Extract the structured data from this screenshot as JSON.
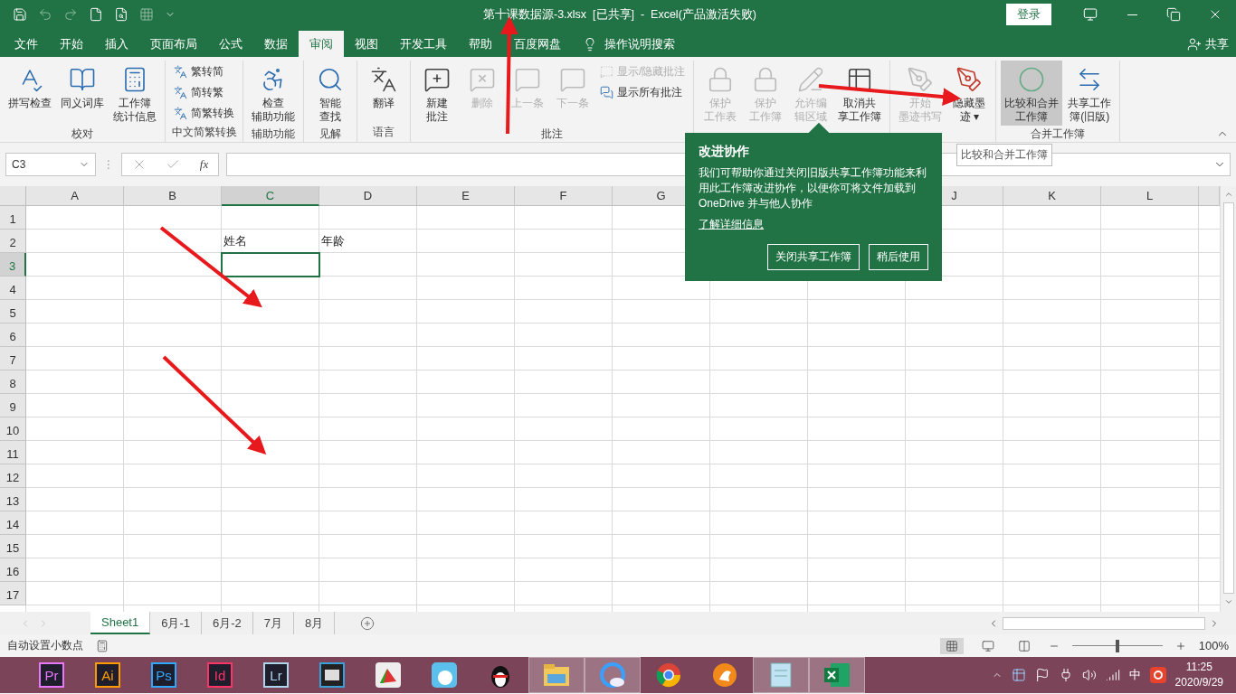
{
  "title_bar": {
    "title": "第十课数据源-3.xlsx  [已共享]  -  Excel(产品激活失败)",
    "login": "登录"
  },
  "tabs": [
    {
      "label": "文件",
      "selected": false
    },
    {
      "label": "开始",
      "selected": false
    },
    {
      "label": "插入",
      "selected": false
    },
    {
      "label": "页面布局",
      "selected": false
    },
    {
      "label": "公式",
      "selected": false
    },
    {
      "label": "数据",
      "selected": false
    },
    {
      "label": "审阅",
      "selected": true
    },
    {
      "label": "视图",
      "selected": false
    },
    {
      "label": "开发工具",
      "selected": false
    },
    {
      "label": "帮助",
      "selected": false
    },
    {
      "label": "百度网盘",
      "selected": false
    }
  ],
  "search": {
    "placeholder": "操作说明搜索"
  },
  "share": "共享",
  "ribbon": {
    "groups": [
      {
        "label": "校对",
        "buttons": [
          {
            "lines": [
              "拼写检查"
            ],
            "disabled": false,
            "highlighted": false
          },
          {
            "lines": [
              "同义词库"
            ],
            "disabled": false,
            "highlighted": false
          },
          {
            "lines": [
              "工作簿",
              "统计信息"
            ],
            "disabled": false,
            "highlighted": false
          }
        ]
      },
      {
        "label": "中文简繁转换",
        "small_items": [
          {
            "label": "繁转简",
            "disabled": false
          },
          {
            "label": "简转繁",
            "disabled": false
          },
          {
            "label": "简繁转换",
            "disabled": false
          }
        ]
      },
      {
        "label": "辅助功能",
        "buttons": [
          {
            "lines": [
              "检查",
              "辅助功能"
            ],
            "disabled": false,
            "highlighted": false
          }
        ]
      },
      {
        "label": "见解",
        "buttons": [
          {
            "lines": [
              "智能",
              "查找"
            ],
            "disabled": false,
            "highlighted": false
          }
        ]
      },
      {
        "label": "语言",
        "buttons": [
          {
            "lines": [
              "翻译"
            ],
            "disabled": false,
            "highlighted": false
          }
        ]
      },
      {
        "label": "批注",
        "buttons": [
          {
            "lines": [
              "新建",
              "批注"
            ],
            "disabled": false,
            "highlighted": false
          },
          {
            "lines": [
              "删除"
            ],
            "disabled": true,
            "highlighted": false
          },
          {
            "lines": [
              "上一条"
            ],
            "disabled": true,
            "highlighted": false
          },
          {
            "lines": [
              "下一条"
            ],
            "disabled": true,
            "highlighted": false
          }
        ],
        "small_items": [
          {
            "label": "显示/隐藏批注",
            "disabled": true
          },
          {
            "label": "显示所有批注",
            "disabled": false
          }
        ]
      },
      {
        "buttons": [
          {
            "lines": [
              "保护",
              "工作表"
            ],
            "disabled": true,
            "highlighted": false
          },
          {
            "lines": [
              "保护",
              "工作簿"
            ],
            "disabled": true,
            "highlighted": false
          },
          {
            "lines": [
              "允许编",
              "辑区域"
            ],
            "disabled": true,
            "highlighted": false
          },
          {
            "lines": [
              "取消共",
              "享工作簿"
            ],
            "disabled": false,
            "highlighted": false
          }
        ]
      },
      {
        "buttons": [
          {
            "lines": [
              "开始",
              "墨迹书写"
            ],
            "disabled": true,
            "highlighted": false
          },
          {
            "lines": [
              "隐藏墨",
              "迹 ▾"
            ],
            "disabled": false,
            "highlighted": false
          }
        ]
      },
      {
        "label": "合并工作簿",
        "buttons": [
          {
            "lines": [
              "比较和合并",
              "工作簿"
            ],
            "disabled": false,
            "highlighted": true
          },
          {
            "lines": [
              "共享工作",
              "簿(旧版)"
            ],
            "disabled": false,
            "highlighted": false
          }
        ]
      }
    ]
  },
  "tooltip": "比较和合并工作簿",
  "formula_bar": {
    "name_box": "C3",
    "separator": "⋮",
    "fx": "fx"
  },
  "grid": {
    "columns": [
      {
        "label": "A",
        "selected": false
      },
      {
        "label": "B",
        "selected": false
      },
      {
        "label": "C",
        "selected": true
      },
      {
        "label": "D",
        "selected": false
      },
      {
        "label": "E",
        "selected": false
      },
      {
        "label": "F",
        "selected": false
      },
      {
        "label": "G",
        "selected": false
      },
      {},
      {},
      {
        "label": "J",
        "selected": false
      },
      {
        "label": "K",
        "selected": false
      },
      {
        "label": "L",
        "selected": false
      }
    ],
    "rows": [
      {
        "label": "1",
        "selected": false
      },
      {
        "label": "2",
        "selected": false,
        "cells": [
          null,
          null,
          "姓名",
          "年龄"
        ]
      },
      {
        "label": "3",
        "selected": true
      },
      {
        "label": "4",
        "selected": false
      },
      {
        "label": "5",
        "selected": false
      },
      {
        "label": "6",
        "selected": false
      },
      {
        "label": "7",
        "selected": false
      },
      {
        "label": "8",
        "selected": false
      },
      {
        "label": "9",
        "selected": false
      },
      {
        "label": "10",
        "selected": false
      },
      {
        "label": "11",
        "selected": false
      },
      {
        "label": "12",
        "selected": false
      },
      {
        "label": "13",
        "selected": false
      },
      {
        "label": "14",
        "selected": false
      },
      {
        "label": "15",
        "selected": false
      },
      {
        "label": "16",
        "selected": false
      },
      {
        "label": "17",
        "selected": false
      }
    ]
  },
  "popup": {
    "title": "改进协作",
    "body": "我们可帮助你通过关闭旧版共享工作簿功能来利用此工作簿改进协作，以便你可将文件加载到 OneDrive 并与他人协作",
    "link": "了解详细信息",
    "buttons": [
      "关闭共享工作簿",
      "稍后使用"
    ]
  },
  "sheet_tabs": [
    {
      "label": "Sheet1",
      "selected": true
    },
    {
      "label": "6月-1",
      "selected": false
    },
    {
      "label": "6月-2",
      "selected": false
    },
    {
      "label": "7月",
      "selected": false
    },
    {
      "label": "8月",
      "selected": false
    }
  ],
  "status_bar": {
    "text": "自动设置小数点",
    "views": [
      {
        "selected": true
      },
      {
        "selected": false
      },
      {
        "selected": false
      }
    ],
    "zoom": {
      "level": 0.5,
      "reading": "100%"
    }
  },
  "taskbar": {
    "apps": [
      {
        "kind": "tile",
        "label": "Pr",
        "color": "#ea77ff",
        "active": false
      },
      {
        "kind": "tile",
        "label": "Ai",
        "color": "#ff9a00",
        "active": false
      },
      {
        "kind": "tile",
        "label": "Ps",
        "color": "#31a8ff",
        "active": false
      },
      {
        "kind": "tile",
        "label": "Id",
        "color": "#ff3366",
        "active": false
      },
      {
        "kind": "tile",
        "label": "Lr",
        "color": "#add5ec",
        "active": false
      },
      {
        "kind": "film",
        "active": false
      },
      {
        "kind": "chart",
        "active": false
      },
      {
        "kind": "bunny",
        "active": false
      },
      {
        "kind": "penguin",
        "active": false
      },
      {
        "kind": "folder",
        "active": true
      },
      {
        "kind": "cloud",
        "active": true
      },
      {
        "kind": "chrome",
        "active": false
      },
      {
        "kind": "fox",
        "active": false
      },
      {
        "kind": "notepad",
        "active": true
      },
      {
        "kind": "excel",
        "active": true
      }
    ],
    "ime": "中",
    "time": "11:25",
    "date": "2020/9/29"
  }
}
